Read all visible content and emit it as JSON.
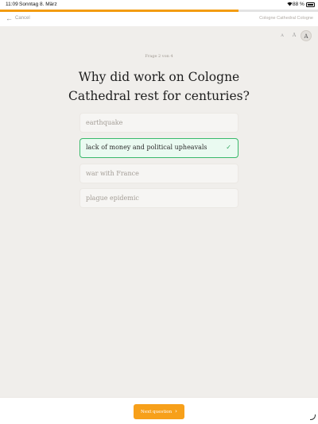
{
  "status_bar": {
    "time": "11:09",
    "date": "Sonntag 8. März",
    "battery_pct": "88 %",
    "wifi_icon": "wifi-icon",
    "battery_icon": "battery-icon"
  },
  "progress": {
    "fraction": 0.75,
    "color": "#f39c12"
  },
  "nav": {
    "cancel_label": "Cancel",
    "cancel_icon": "arrow-left-icon",
    "title": "Cologne Cathedral Cologne"
  },
  "font_size_options": [
    "A",
    "A",
    "A"
  ],
  "quiz": {
    "counter": "Frage 2 von 4",
    "question": "Why did work on Cologne Cathedral rest for centuries?",
    "answers": [
      {
        "label": "earthquake",
        "selected": false
      },
      {
        "label": "lack of money and political upheavals",
        "selected": true
      },
      {
        "label": "war with France",
        "selected": false
      },
      {
        "label": "plague epidemic",
        "selected": false
      }
    ],
    "selected_color": "#39b96b"
  },
  "footer": {
    "next_label": "Next question",
    "next_icon": "chevron-right-icon",
    "accent": "#f7a01a"
  }
}
